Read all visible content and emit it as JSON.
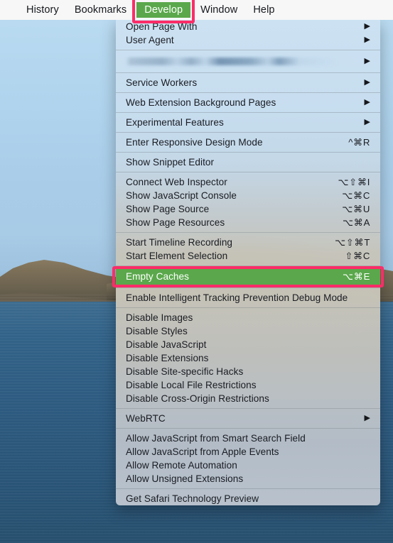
{
  "menubar": {
    "items": [
      {
        "label": "History",
        "highlighted": false
      },
      {
        "label": "Bookmarks",
        "highlighted": false
      },
      {
        "label": "Develop",
        "highlighted": true
      },
      {
        "label": "Window",
        "highlighted": false
      },
      {
        "label": "Help",
        "highlighted": false
      }
    ]
  },
  "menu": {
    "owner": "Develop",
    "groups": [
      {
        "items": [
          {
            "label": "Open Page With",
            "shortcut": "",
            "submenu": true,
            "kind": "item"
          },
          {
            "label": "User Agent",
            "shortcut": "",
            "submenu": true,
            "kind": "item"
          }
        ]
      },
      {
        "items": [
          {
            "label": "",
            "shortcut": "",
            "submenu": true,
            "kind": "redacted"
          }
        ]
      },
      {
        "items": [
          {
            "label": "Service Workers",
            "shortcut": "",
            "submenu": true,
            "kind": "item"
          }
        ]
      },
      {
        "items": [
          {
            "label": "Web Extension Background Pages",
            "shortcut": "",
            "submenu": true,
            "kind": "item"
          }
        ]
      },
      {
        "items": [
          {
            "label": "Experimental Features",
            "shortcut": "",
            "submenu": true,
            "kind": "item"
          }
        ]
      },
      {
        "items": [
          {
            "label": "Enter Responsive Design Mode",
            "shortcut": "^⌘R",
            "submenu": false,
            "kind": "item"
          }
        ]
      },
      {
        "items": [
          {
            "label": "Show Snippet Editor",
            "shortcut": "",
            "submenu": false,
            "kind": "item"
          }
        ]
      },
      {
        "items": [
          {
            "label": "Connect Web Inspector",
            "shortcut": "⌥⇧⌘I",
            "submenu": false,
            "kind": "item"
          },
          {
            "label": "Show JavaScript Console",
            "shortcut": "⌥⌘C",
            "submenu": false,
            "kind": "item"
          },
          {
            "label": "Show Page Source",
            "shortcut": "⌥⌘U",
            "submenu": false,
            "kind": "item"
          },
          {
            "label": "Show Page Resources",
            "shortcut": "⌥⌘A",
            "submenu": false,
            "kind": "item"
          }
        ]
      },
      {
        "items": [
          {
            "label": "Start Timeline Recording",
            "shortcut": "⌥⇧⌘T",
            "submenu": false,
            "kind": "item"
          },
          {
            "label": "Start Element Selection",
            "shortcut": "⇧⌘C",
            "submenu": false,
            "kind": "item"
          }
        ]
      },
      {
        "items": [
          {
            "label": "Empty Caches",
            "shortcut": "⌥⌘E",
            "submenu": false,
            "kind": "target"
          }
        ]
      },
      {
        "items": [
          {
            "label": "Enable Intelligent Tracking Prevention Debug Mode",
            "shortcut": "",
            "submenu": false,
            "kind": "item"
          }
        ]
      },
      {
        "items": [
          {
            "label": "Disable Images",
            "shortcut": "",
            "submenu": false,
            "kind": "item"
          },
          {
            "label": "Disable Styles",
            "shortcut": "",
            "submenu": false,
            "kind": "item"
          },
          {
            "label": "Disable JavaScript",
            "shortcut": "",
            "submenu": false,
            "kind": "item"
          },
          {
            "label": "Disable Extensions",
            "shortcut": "",
            "submenu": false,
            "kind": "item"
          },
          {
            "label": "Disable Site-specific Hacks",
            "shortcut": "",
            "submenu": false,
            "kind": "item"
          },
          {
            "label": "Disable Local File Restrictions",
            "shortcut": "",
            "submenu": false,
            "kind": "item"
          },
          {
            "label": "Disable Cross-Origin Restrictions",
            "shortcut": "",
            "submenu": false,
            "kind": "item"
          }
        ]
      },
      {
        "items": [
          {
            "label": "WebRTC",
            "shortcut": "",
            "submenu": true,
            "kind": "item"
          }
        ]
      },
      {
        "items": [
          {
            "label": "Allow JavaScript from Smart Search Field",
            "shortcut": "",
            "submenu": false,
            "kind": "item"
          },
          {
            "label": "Allow JavaScript from Apple Events",
            "shortcut": "",
            "submenu": false,
            "kind": "item"
          },
          {
            "label": "Allow Remote Automation",
            "shortcut": "",
            "submenu": false,
            "kind": "item"
          },
          {
            "label": "Allow Unsigned Extensions",
            "shortcut": "",
            "submenu": false,
            "kind": "item"
          }
        ]
      },
      {
        "items": [
          {
            "label": "Get Safari Technology Preview",
            "shortcut": "",
            "submenu": false,
            "kind": "item"
          }
        ]
      }
    ]
  },
  "icons": {
    "submenu_arrow": "▶"
  },
  "colors": {
    "highlight_green": "#5aa84b",
    "annotation_pink": "#fb2c68",
    "menubar_background": "#f7f7f7",
    "menu_text": "#1a1c22"
  },
  "wallpaper": {
    "description": "coastal landscape with sky, hills and sea",
    "sky": "#b4d7ef",
    "hill": "#7b6c55",
    "sea": "#33648a"
  }
}
